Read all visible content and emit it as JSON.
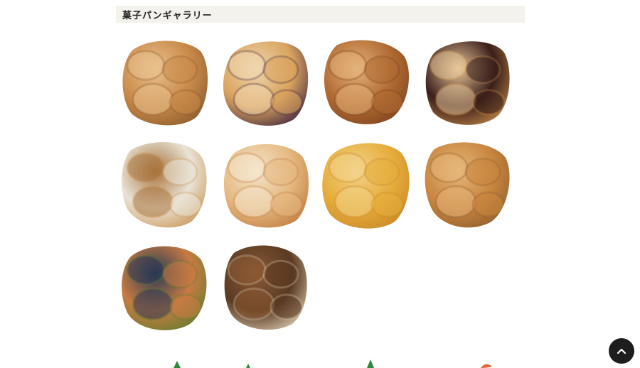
{
  "section": {
    "title": "菓子パンギャラリー"
  },
  "gallery": {
    "items": [
      {
        "name": "photo-croissants",
        "icon": "pastry-photo",
        "colors": [
          "#c98a4a",
          "#8a5a2b",
          "#e9c28e"
        ]
      },
      {
        "name": "photo-blueberry-danish",
        "icon": "pastry-photo",
        "colors": [
          "#d9a35e",
          "#3b2140",
          "#f0d7b0"
        ]
      },
      {
        "name": "photo-cocoa-loaves",
        "icon": "pastry-photo",
        "colors": [
          "#b06a32",
          "#7a3f1c",
          "#e3b27a"
        ]
      },
      {
        "name": "photo-chocolate-donuts",
        "icon": "pastry-photo",
        "colors": [
          "#3a1f1a",
          "#c98c4a",
          "#e8c79a"
        ]
      },
      {
        "name": "photo-sugar-sticks",
        "icon": "pastry-photo",
        "colors": [
          "#e9e3d6",
          "#c9914f",
          "#a8733c"
        ]
      },
      {
        "name": "photo-bean-buns",
        "icon": "pastry-photo",
        "colors": [
          "#e5b981",
          "#c07a3d",
          "#f5e6cc"
        ]
      },
      {
        "name": "photo-melon-pan",
        "icon": "pastry-photo",
        "colors": [
          "#e6ad3c",
          "#c98625",
          "#f3d38a"
        ]
      },
      {
        "name": "photo-twisted-rolls",
        "icon": "pastry-photo",
        "colors": [
          "#c8853f",
          "#8b5b2c",
          "#e6b77a"
        ]
      },
      {
        "name": "photo-matcha-swirls",
        "icon": "pastry-photo",
        "colors": [
          "#c77b42",
          "#5b7d2e",
          "#2b3a55"
        ]
      },
      {
        "name": "photo-marble-cakes",
        "icon": "pastry-photo",
        "colors": [
          "#5a3a22",
          "#e2d2b8",
          "#8a5a34"
        ]
      }
    ]
  },
  "footer": {
    "back_to_top_icon": "chevron-up-icon"
  }
}
